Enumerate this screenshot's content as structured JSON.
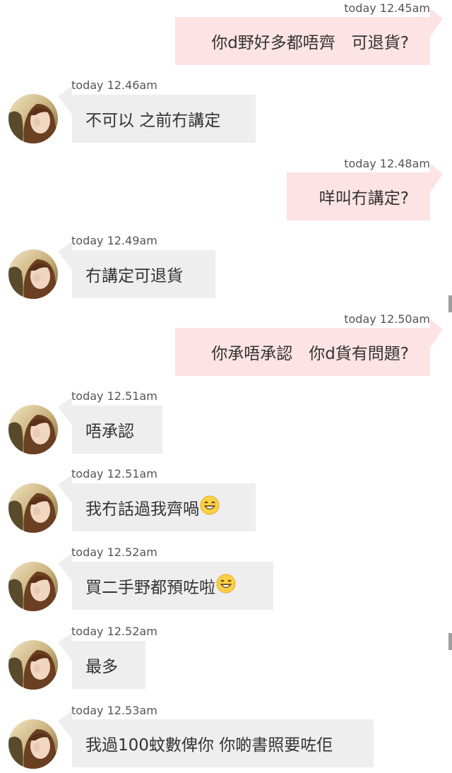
{
  "colors": {
    "incoming_bubble": "#eeeeee",
    "outgoing_bubble": "#fde3e4",
    "text": "#333333",
    "timestamp": "#555555"
  },
  "messages": [
    {
      "direction": "outgoing",
      "time": "today 12.45am",
      "text": "你d野好多都唔齊　可退貨?"
    },
    {
      "direction": "incoming",
      "time": "today 12.46am",
      "text": "不可以 之前冇講定",
      "avatar": "avatar-photo"
    },
    {
      "direction": "outgoing",
      "time": "today 12.48am",
      "text": "咩叫冇講定?"
    },
    {
      "direction": "incoming",
      "time": "today 12.49am",
      "text": "冇講定可退貨",
      "avatar": "avatar-photo"
    },
    {
      "direction": "outgoing",
      "time": "today 12.50am",
      "text": "你承唔承認　你d貨有問題?"
    },
    {
      "direction": "incoming",
      "time": "today 12.51am",
      "text": "唔承認",
      "avatar": "avatar-photo"
    },
    {
      "direction": "incoming",
      "time": "today 12.51am",
      "text": "我冇話過我齊喎",
      "emoji": "grinning-face-icon",
      "avatar": "avatar-photo"
    },
    {
      "direction": "incoming",
      "time": "today 12.52am",
      "text": "買二手野都預咗啦",
      "emoji": "grinning-face-icon",
      "avatar": "avatar-photo"
    },
    {
      "direction": "incoming",
      "time": "today 12.52am",
      "text": "最多",
      "avatar": "avatar-photo"
    },
    {
      "direction": "incoming",
      "time": "today 12.53am",
      "text": "我過100蚊數俾你 你啲書照要咗佢",
      "avatar": "avatar-photo"
    }
  ]
}
